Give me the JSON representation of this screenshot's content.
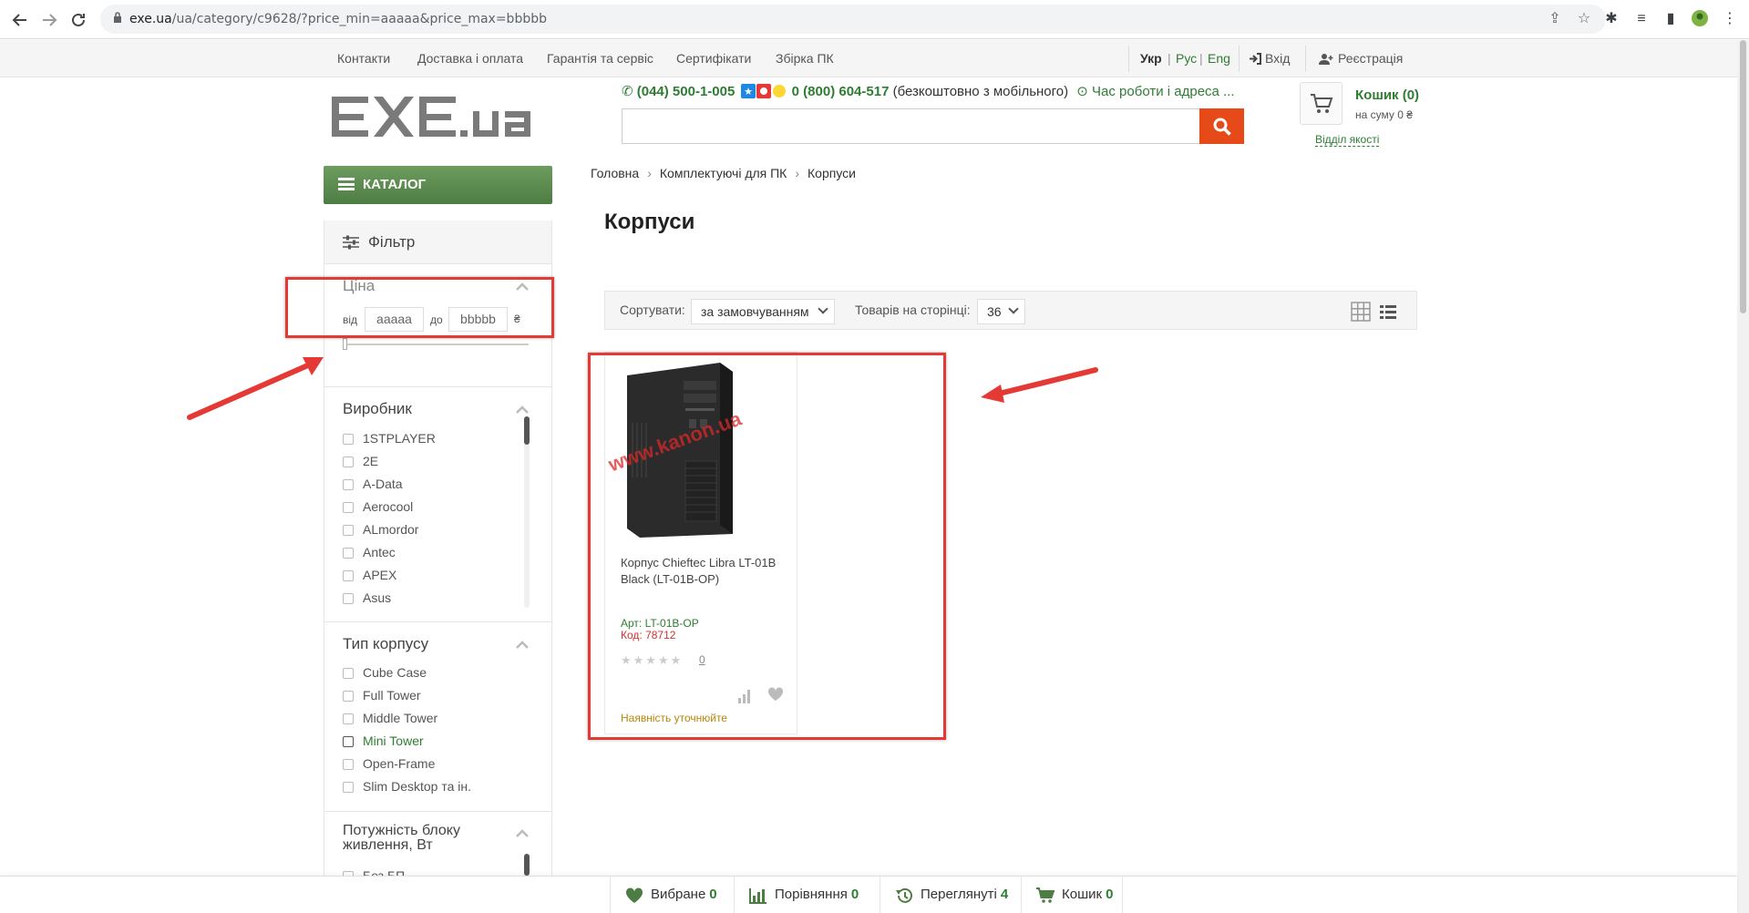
{
  "browser": {
    "url_host": "exe.ua",
    "url_path": "/ua/category/c9628/?price_min=aaaaa&price_max=bbbbb"
  },
  "topbar": {
    "links": [
      "Контакти",
      "Доставка і оплата",
      "Гарантія та сервіс",
      "Сертифікати",
      "Збірка ПК"
    ],
    "languages": [
      "Укр",
      "Рус",
      "Eng"
    ],
    "login": "Вхід",
    "register": "Реєстрація"
  },
  "header": {
    "logo_text": "EXE.ua",
    "phone1": "(044) 500-1-005",
    "phone2": "0 (800) 604-517",
    "phone2_note": "(безкоштовно з мобільного)",
    "hours": "Час роботи і адреса ...",
    "cart_title": "Кошик (0)",
    "cart_sum": "на суму 0 ₴",
    "quality": "Відділ якості"
  },
  "catalog_button": "КАТАЛОГ",
  "filter": {
    "title": "Фільтр",
    "price": {
      "title": "Ціна",
      "from_label": "від",
      "to_label": "до",
      "min_value": "aaaaa",
      "max_value": "bbbbb",
      "currency": "₴"
    },
    "manufacturer": {
      "title": "Виробник",
      "items": [
        "1STPLAYER",
        "2E",
        "A-Data",
        "Aerocool",
        "ALmordor",
        "Antec",
        "APEX",
        "Asus"
      ]
    },
    "case_type": {
      "title": "Тип корпусу",
      "items": [
        "Cube Case",
        "Full Tower",
        "Middle Tower",
        "Mini Tower",
        "Open-Frame",
        "Slim Desktop та ін."
      ]
    },
    "psu_power": {
      "title": "Потужність блоку живлення, Вт",
      "first_item": "Без БП"
    }
  },
  "breadcrumb": [
    "Головна",
    "Комплектуючі для ПК",
    "Корпуси"
  ],
  "page_title": "Корпуси",
  "sortbar": {
    "sort_label": "Сортувати:",
    "sort_value": "за замовчуванням",
    "per_page_label": "Товарів на сторінці:",
    "per_page_value": "36"
  },
  "product": {
    "name": "Корпус Chieftec Libra LT-01B Black (LT-01B-OP)",
    "art": "Арт: LT-01B-OP",
    "code": "Код: 78712",
    "stars": "★★★★★",
    "rating_count": "0",
    "availability": "Наявність уточнюйте",
    "watermark": "www.kanon.ua"
  },
  "bottombar": [
    {
      "label": "Вибране",
      "count": "0"
    },
    {
      "label": "Порівняння",
      "count": "0"
    },
    {
      "label": "Переглянуті",
      "count": "4"
    },
    {
      "label": "Кошик",
      "count": "0"
    }
  ],
  "colors": {
    "brand_green": "#2e7d32",
    "search_orange": "#e64a19",
    "annotation_red": "#e53935"
  }
}
